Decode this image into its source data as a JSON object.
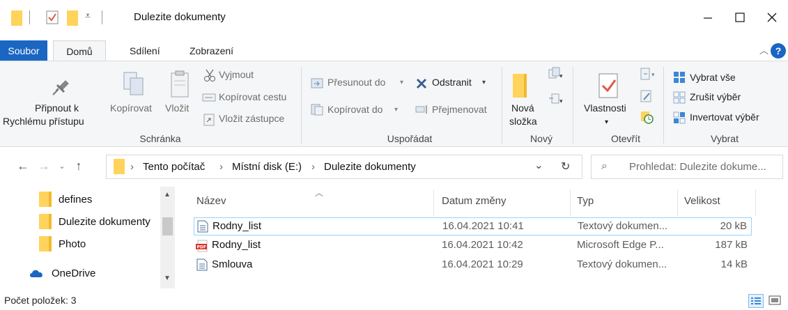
{
  "window": {
    "title": "Dulezite dokumenty"
  },
  "ribbon_tabs": [
    "Soubor",
    "Domů",
    "Sdílení",
    "Zobrazení"
  ],
  "ribbon": {
    "clipboard": {
      "pin_label_1": "Připnout k",
      "pin_label_2": "Rychlému přístupu",
      "copy": "Kopírovat",
      "paste": "Vložit",
      "cut": "Vyjmout",
      "copy_path": "Kopírovat cestu",
      "paste_shortcut": "Vložit zástupce",
      "group": "Schránka"
    },
    "organize": {
      "move_to": "Přesunout do",
      "copy_to": "Kopírovat do",
      "delete": "Odstranit",
      "rename": "Přejmenovat",
      "group": "Uspořádat"
    },
    "new": {
      "new_folder_1": "Nová",
      "new_folder_2": "složka",
      "group": "Nový"
    },
    "open": {
      "properties": "Vlastnosti",
      "group": "Otevřít"
    },
    "select": {
      "select_all": "Vybrat vše",
      "select_none": "Zrušit výběr",
      "invert": "Invertovat výběr",
      "group": "Vybrat"
    }
  },
  "address": {
    "crumbs": [
      "Tento počítač",
      "Místní disk (E:)",
      "Dulezite dokumenty"
    ],
    "search_placeholder": "Prohledat: Dulezite dokume..."
  },
  "nav_pane": {
    "items": [
      "defines",
      "Dulezite dokumenty",
      "Photo",
      "OneDrive"
    ]
  },
  "file_list": {
    "columns": [
      "Název",
      "Datum změny",
      "Typ",
      "Velikost"
    ],
    "rows": [
      {
        "name": "Rodny_list",
        "date": "16.04.2021 10:41",
        "type": "Textový dokumen...",
        "size": "20 kB",
        "icon": "text-file-icon"
      },
      {
        "name": "Rodny_list",
        "date": "16.04.2021 10:42",
        "type": "Microsoft Edge P...",
        "size": "187 kB",
        "icon": "pdf-file-icon"
      },
      {
        "name": "Smlouva",
        "date": "16.04.2021 10:29",
        "type": "Textový dokumen...",
        "size": "14 kB",
        "icon": "text-file-icon"
      }
    ]
  },
  "status_bar": {
    "count": "Počet položek: 3"
  },
  "colors": {
    "accent": "#1a66c2",
    "folder": "#ffd35c",
    "selection_border": "#99d1ff"
  }
}
